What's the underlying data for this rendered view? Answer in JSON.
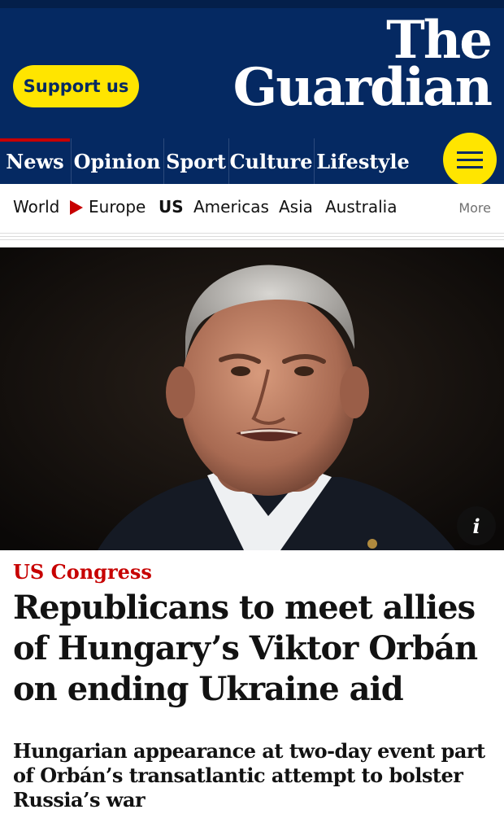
{
  "header": {
    "support_label": "Support us",
    "logo_line1": "The",
    "logo_line2": "Guardian",
    "brand_color": "#052962",
    "accent_color": "#ffe500"
  },
  "pillars": [
    {
      "label": "News",
      "active": true
    },
    {
      "label": "Opinion",
      "active": false
    },
    {
      "label": "Sport",
      "active": false
    },
    {
      "label": "Culture",
      "active": false
    },
    {
      "label": "Lifestyle",
      "active": false
    }
  ],
  "menu": {
    "icon": "hamburger-menu-icon"
  },
  "subnav": {
    "items": [
      "World",
      "Europe",
      "US",
      "Americas",
      "Asia",
      "Australia"
    ],
    "current_section": "US",
    "separator_icon": "triangle-right-icon",
    "more_label": "More"
  },
  "article": {
    "image_alt": "Viktor Orbán",
    "info_icon_label": "i",
    "kicker": "US Congress",
    "headline": "Republicans to meet allies of Hungary’s Viktor Orbán on ending Ukraine aid",
    "standfirst": "Hungarian appearance at two-day event part of Orbán’s transatlantic attempt to bolster Russia’s war",
    "kicker_color": "#c70000"
  }
}
